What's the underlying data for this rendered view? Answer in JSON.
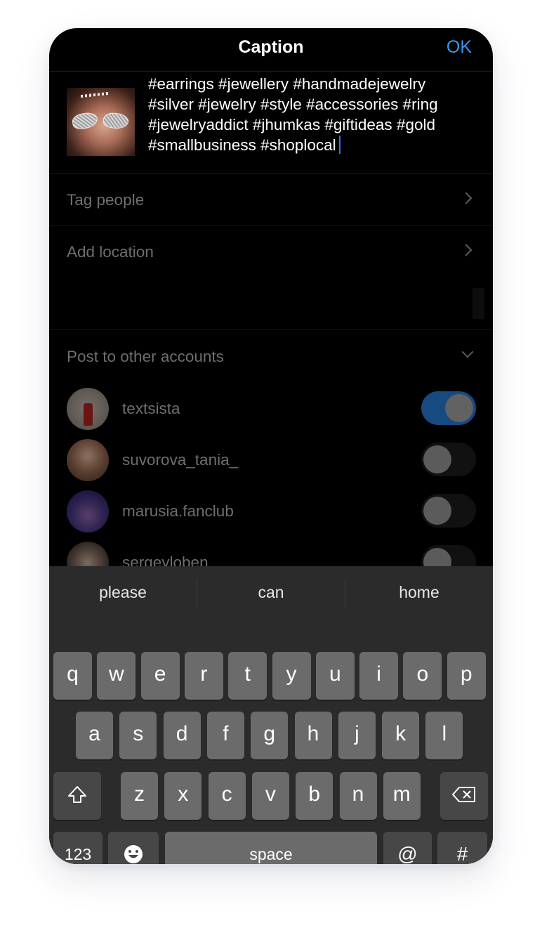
{
  "header": {
    "title": "Caption",
    "ok_label": "OK"
  },
  "caption": {
    "thumbnail": "post-photo",
    "lines": [
      "#earrings #jewellery #handmadejewelry",
      "#silver #jewelry #style #accessories #ring",
      "#jewelryaddict #jhumkas #giftideas #gold",
      "#smallbusiness #shoplocal"
    ]
  },
  "rows": {
    "tag_people": "Tag people",
    "add_location": "Add location"
  },
  "post_to_other": {
    "label": "Post to other accounts",
    "accounts": [
      {
        "username": "textsista",
        "enabled": true
      },
      {
        "username": "suvorova_tania_",
        "enabled": false
      },
      {
        "username": "marusia.fanclub",
        "enabled": false
      },
      {
        "username": "sergeyloben",
        "enabled": false
      }
    ]
  },
  "keyboard": {
    "suggestions": [
      "please",
      "can",
      "home"
    ],
    "row1": [
      "q",
      "w",
      "e",
      "r",
      "t",
      "y",
      "u",
      "i",
      "o",
      "p"
    ],
    "row2": [
      "a",
      "s",
      "d",
      "f",
      "g",
      "h",
      "j",
      "k",
      "l"
    ],
    "row3": [
      "z",
      "x",
      "c",
      "v",
      "b",
      "n",
      "m"
    ],
    "shift_icon": "shift-icon",
    "delete_icon": "backspace-icon",
    "numbers_label": "123",
    "emoji_icon": "emoji-icon",
    "space_label": "space",
    "at_label": "@",
    "hash_label": "#"
  },
  "colors": {
    "accent": "#3897f0",
    "toggle_on": "#174a80",
    "cursor": "#3a6ff7"
  }
}
